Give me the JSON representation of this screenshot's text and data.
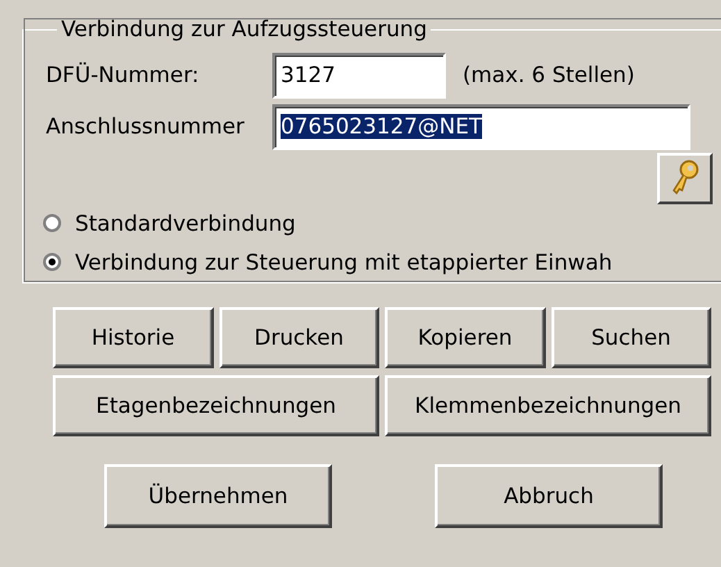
{
  "group": {
    "title": "Verbindung zur Aufzugssteuerung",
    "dfu": {
      "label": "DFÜ-Nummer:",
      "value": "3127",
      "hint": "(max. 6 Stellen)"
    },
    "anschluss": {
      "label": "Anschlussnummer",
      "value": "0765023127@NET",
      "text_selected": true
    },
    "options": [
      {
        "label": "Standardverbindung",
        "selected": false
      },
      {
        "label": "Verbindung zur Steuerung mit etappierter Einwah",
        "selected": true
      }
    ]
  },
  "tool_buttons": [
    [
      "Historie",
      "Drucken",
      "Kopieren",
      "Suchen"
    ],
    [
      "Etagenbezeichnungen",
      "Klemmenbezeichnungen"
    ]
  ],
  "dialog_buttons": [
    "Übernehmen",
    "Abbruch"
  ]
}
